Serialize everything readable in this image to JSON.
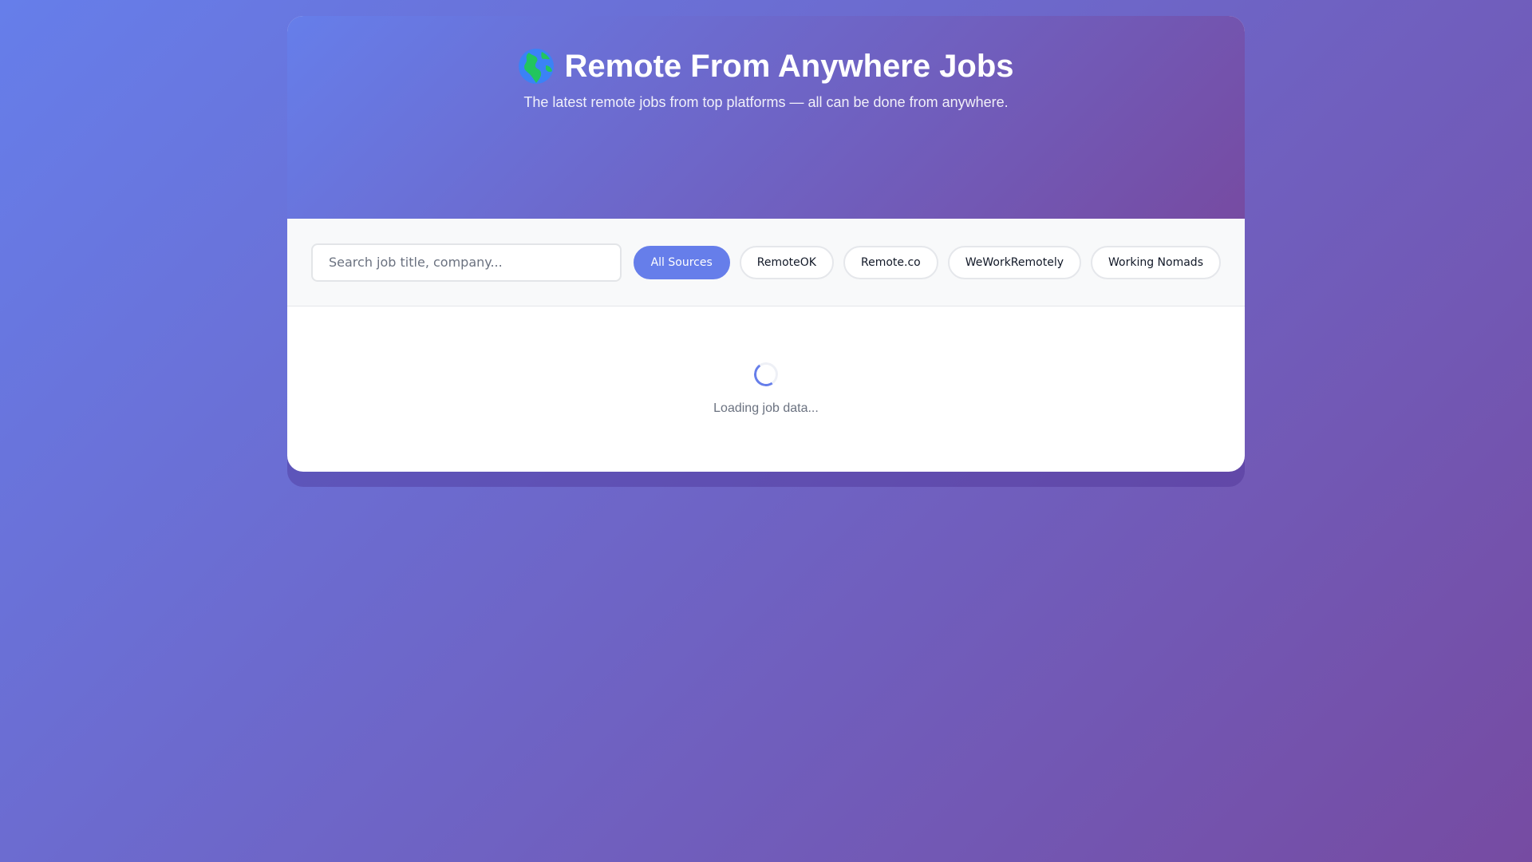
{
  "header": {
    "icon": "globe-icon",
    "title": "Remote From Anywhere Jobs",
    "subtitle": "The latest remote jobs from top platforms — all can be done from anywhere."
  },
  "search": {
    "placeholder": "Search job title, company...",
    "value": ""
  },
  "filters": [
    {
      "label": "All Sources",
      "active": true
    },
    {
      "label": "RemoteOK",
      "active": false
    },
    {
      "label": "Remote.co",
      "active": false
    },
    {
      "label": "WeWorkRemotely",
      "active": false
    },
    {
      "label": "Working Nomads",
      "active": false
    }
  ],
  "loading": {
    "text": "Loading job data...",
    "icon": "spinner-icon"
  },
  "colors": {
    "accent": "#667eea",
    "gradient_start": "#667eea",
    "gradient_end": "#764ba2"
  }
}
